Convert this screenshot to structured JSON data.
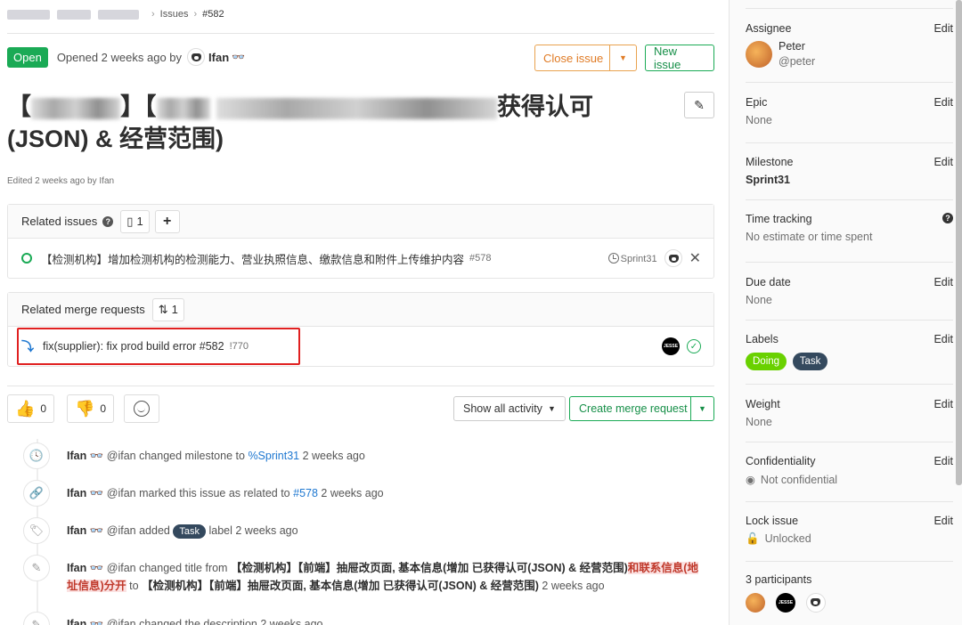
{
  "breadcrumb": {
    "issues": "Issues",
    "current": "#582"
  },
  "issue": {
    "status": "Open",
    "opened_text": "Opened 2 weeks ago by",
    "author": "Ifan",
    "title_visible_start": "【",
    "title_visible_mid": "】【",
    "title_visible_end": "获得认可",
    "title_line2": "(JSON) & 经营范围)",
    "edited": "Edited 2 weeks ago by Ifan"
  },
  "actions": {
    "close": "Close issue",
    "new": "New issue"
  },
  "related_issues": {
    "label": "Related issues",
    "count": "1",
    "items": [
      {
        "text": "【检测机构】增加检测机构的检测能力、营业执照信息、缴款信息和附件上传维护内容",
        "ref": "#578",
        "milestone": "Sprint31"
      }
    ]
  },
  "related_mrs": {
    "label": "Related merge requests",
    "count": "1",
    "items": [
      {
        "text": "fix(supplier): fix prod build error #582",
        "ref": "!770",
        "avatar": "JESSE"
      }
    ]
  },
  "emoji": {
    "thumbs_up": "0",
    "thumbs_down": "0"
  },
  "activity": {
    "filter": "Show all activity",
    "create_mr": "Create merge request"
  },
  "notes": [
    {
      "author": "Ifan",
      "handle": "@ifan",
      "text_a": "changed milestone to",
      "link": "%Sprint31",
      "time": "2 weeks ago"
    },
    {
      "author": "Ifan",
      "handle": "@ifan",
      "text_a": "marked this issue as related to",
      "link": "#578",
      "time": "2 weeks ago"
    },
    {
      "author": "Ifan",
      "handle": "@ifan",
      "text_a": "added",
      "label": "Task",
      "text_b": "label",
      "time": "2 weeks ago"
    },
    {
      "author": "Ifan",
      "handle": "@ifan",
      "text_a": "changed title from",
      "from_title": "【检测机构】【前端】抽屉改页面, 基本信息(增加 已获得认可(JSON) & 经营范围)",
      "removed": "和联系信息(地址信息)分开",
      "to_word": "to",
      "to_title": "【检测机构】【前端】抽屉改页面, 基本信息(增加 已获得认可(JSON) & 经营范围)",
      "time": "2 weeks ago"
    },
    {
      "author": "Ifan",
      "handle": "@ifan",
      "text_a": "changed the description",
      "time": "2 weeks ago"
    }
  ],
  "sidebar": {
    "edit": "Edit",
    "assignee": {
      "label": "Assignee",
      "name": "Peter",
      "username": "@peter"
    },
    "epic": {
      "label": "Epic",
      "value": "None"
    },
    "milestone": {
      "label": "Milestone",
      "value": "Sprint31"
    },
    "time_tracking": {
      "label": "Time tracking",
      "value": "No estimate or time spent"
    },
    "due_date": {
      "label": "Due date",
      "value": "None"
    },
    "labels": {
      "label": "Labels",
      "items": [
        {
          "name": "Doing",
          "color": "#69d100"
        },
        {
          "name": "Task",
          "color": "#34495e"
        }
      ]
    },
    "weight": {
      "label": "Weight",
      "value": "None"
    },
    "confidentiality": {
      "label": "Confidentiality",
      "value": "Not confidential"
    },
    "lock": {
      "label": "Lock issue",
      "value": "Unlocked"
    },
    "participants": {
      "label": "3 participants"
    }
  },
  "colors": {
    "accent_green": "#1aaa55",
    "close_orange": "#e07b25",
    "link_blue": "#1f78d1"
  }
}
